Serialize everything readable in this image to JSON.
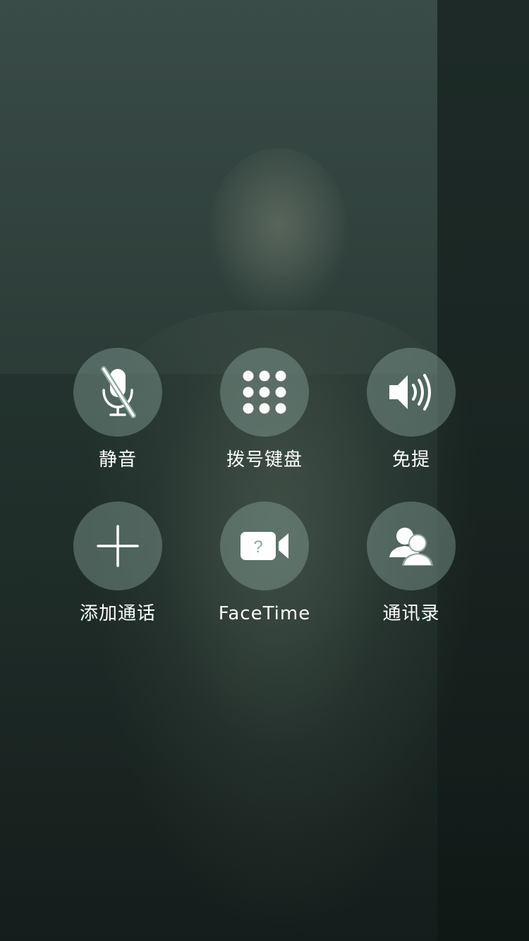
{
  "controls": {
    "mute": {
      "label": "静音",
      "icon": "microphone-muted-icon"
    },
    "keypad": {
      "label": "拨号键盘",
      "icon": "keypad-grid-icon"
    },
    "speaker": {
      "label": "免提",
      "icon": "speaker-icon"
    },
    "add_call": {
      "label": "添加通话",
      "icon": "plus-icon"
    },
    "facetime": {
      "label": "FaceTime",
      "icon": "video-camera-question-icon"
    },
    "contacts": {
      "label": "通讯录",
      "icon": "contacts-icon"
    }
  },
  "colors": {
    "button_fill": "#8caaa0",
    "label": "#ffffff",
    "icon": "#ffffff"
  }
}
